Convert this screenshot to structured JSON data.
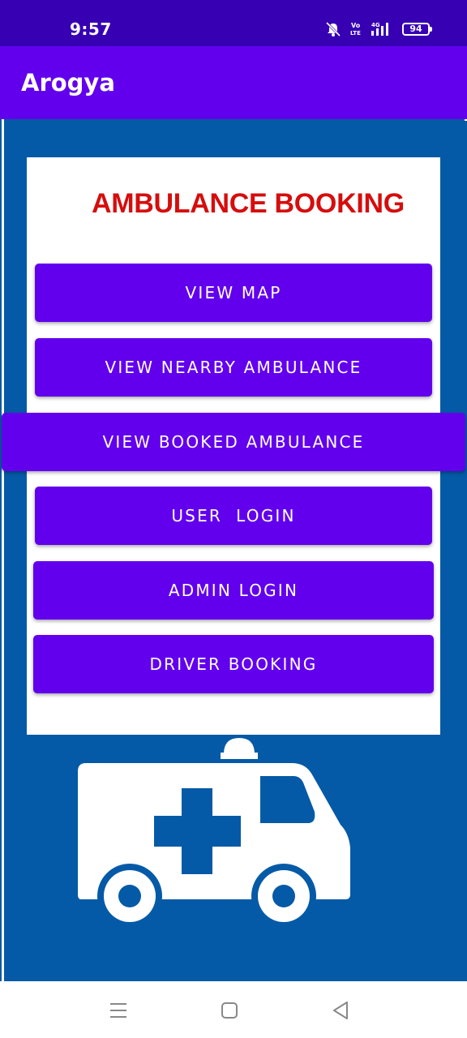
{
  "status_bar": {
    "time": "9:57",
    "battery": "94",
    "icons": [
      "mute-icon",
      "volte-icon",
      "signal-4g-icon",
      "battery-icon"
    ]
  },
  "app_bar": {
    "title": "Arogya"
  },
  "card": {
    "title": "AMBULANCE BOOKING"
  },
  "buttons": {
    "view_map": "VIEW MAP",
    "view_nearby": "VIEW NEARBY AMBULANCE",
    "view_booked": "VIEW BOOKED AMBULANCE",
    "user_login": "USER  LOGIN",
    "admin_login": "ADMIN LOGIN",
    "driver_booking": "DRIVER BOOKING"
  },
  "nav_bar": {
    "icons": [
      "menu-icon",
      "home-icon",
      "back-icon"
    ]
  },
  "colors": {
    "status_bar": "#3700B3",
    "app_bar": "#6200EE",
    "button": "#6200EE",
    "background": "#045AA6",
    "title_red": "#D60D0D"
  }
}
